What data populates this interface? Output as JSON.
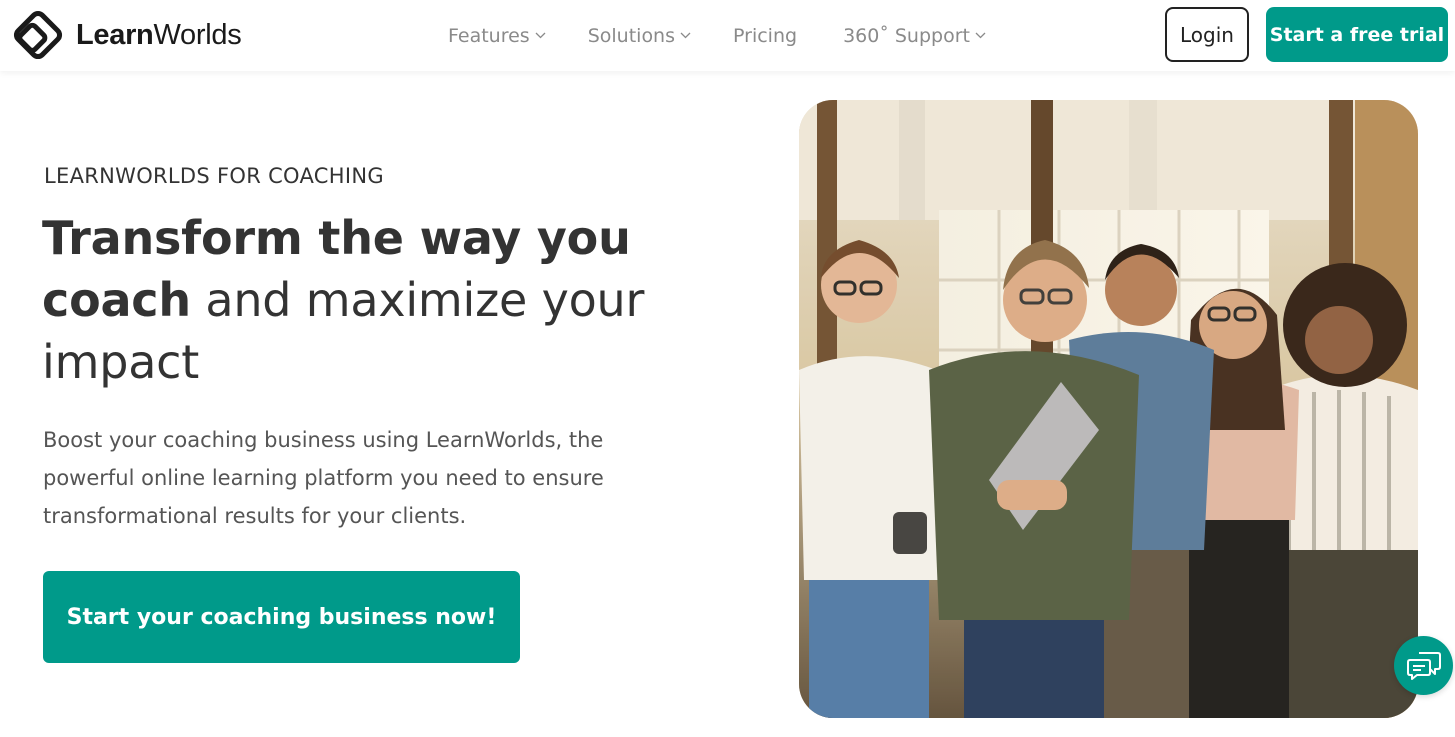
{
  "brand": {
    "name_bold": "Learn",
    "name_regular": "Worlds",
    "accent_color": "#009a8a"
  },
  "nav": {
    "items": [
      {
        "label": "Features",
        "has_dropdown": true
      },
      {
        "label": "Solutions",
        "has_dropdown": true
      },
      {
        "label": "Pricing",
        "has_dropdown": false
      },
      {
        "label": "360˚ Support",
        "has_dropdown": true
      }
    ],
    "login_label": "Login",
    "trial_label": "Start a free trial"
  },
  "hero": {
    "eyebrow": "LEARNWORLDS FOR COACHING",
    "headline_bold_1": "Transform the way you",
    "headline_bold_2": "coach",
    "headline_regular_1": " and maximize your",
    "headline_regular_2": "impact",
    "subtext": "Boost your coaching business using LearnWorlds, the powerful online learning platform you need to ensure transformational results for your clients.",
    "cta_label": "Start your coaching business now!",
    "photo_icon": "team-photo"
  },
  "chat": {
    "icon": "chat-bubbles-icon"
  }
}
